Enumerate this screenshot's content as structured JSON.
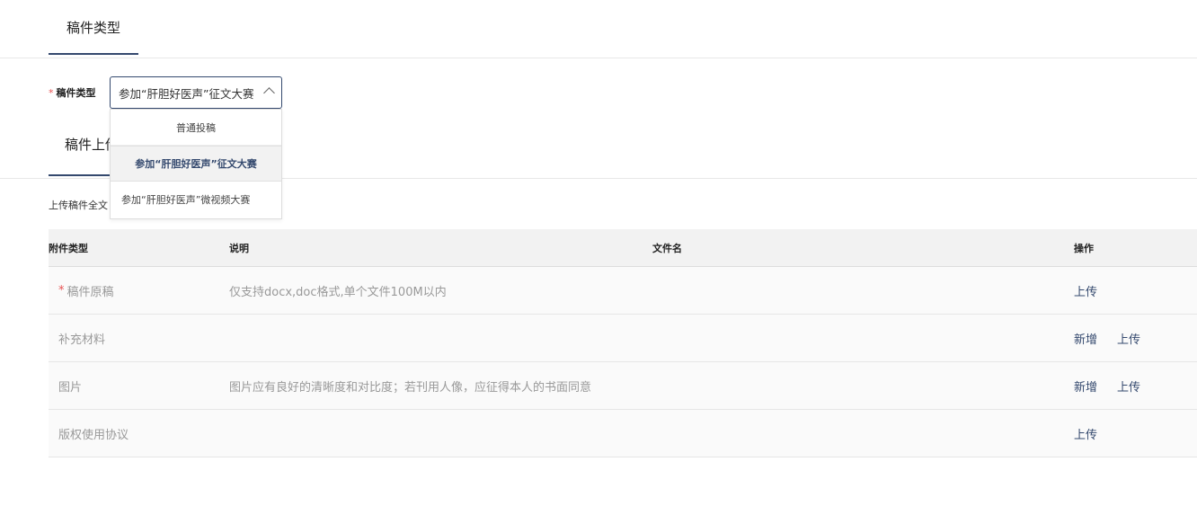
{
  "tabs": {
    "type_tab": "稿件类型",
    "upload_tab": "稿件上传"
  },
  "form": {
    "required_mark": "*",
    "type_label": "稿件类型",
    "selected_value": "参加“肝胆好医声”征文大赛"
  },
  "dropdown": {
    "options": [
      {
        "label": "普通投稿",
        "selected": false
      },
      {
        "label": "参加“肝胆好医声”征文大赛",
        "selected": true
      },
      {
        "label": "参加“肝胆好医声”微视频大赛",
        "selected": false
      }
    ]
  },
  "upload_note": "上传稿件全文",
  "table": {
    "headers": {
      "type": "附件类型",
      "desc": "说明",
      "file": "文件名",
      "ops": "操作"
    },
    "rows": [
      {
        "required": "*",
        "type": "稿件原稿",
        "desc": "仅支持docx,doc格式,单个文件100M以内",
        "file": "",
        "add": "",
        "upload": "上传"
      },
      {
        "required": "",
        "type": "补充材料",
        "desc": "",
        "file": "",
        "add": "新增",
        "upload": "上传"
      },
      {
        "required": "",
        "type": "图片",
        "desc": "图片应有良好的清晰度和对比度；若刊用人像，应征得本人的书面同意",
        "file": "",
        "add": "新增",
        "upload": "上传"
      },
      {
        "required": "",
        "type": "版权使用协议",
        "desc": "",
        "file": "",
        "add": "",
        "upload": "上传"
      }
    ]
  },
  "colors": {
    "accent": "#34496e",
    "required": "#e85252",
    "muted_text": "#999999",
    "header_bg": "#f2f2f2"
  }
}
